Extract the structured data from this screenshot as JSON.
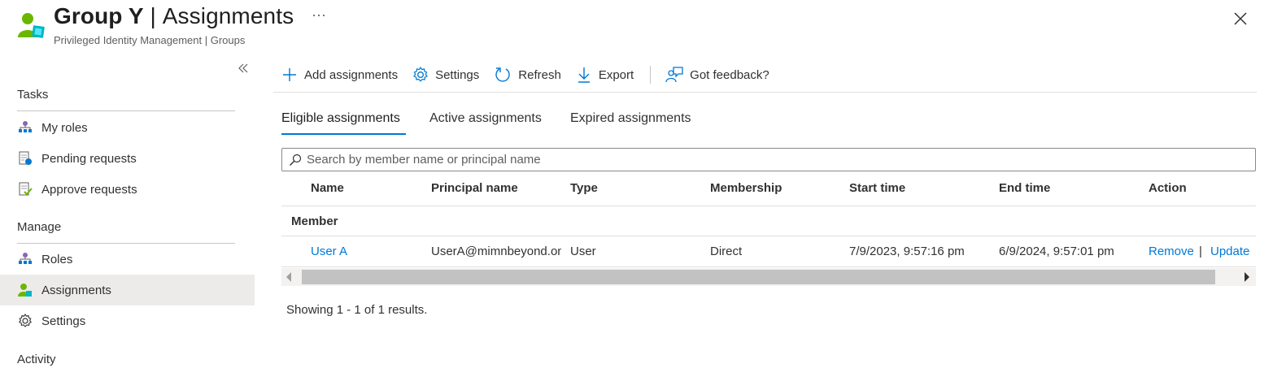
{
  "header": {
    "title_group": "Group Y",
    "title_separator": " | ",
    "title_page": "Assignments",
    "subtitle": "Privileged Identity Management | Groups",
    "more_label": "···"
  },
  "sidebar": {
    "sections": [
      {
        "heading": "Tasks",
        "items": [
          {
            "label": "My roles",
            "icon": "my-roles-icon"
          },
          {
            "label": "Pending requests",
            "icon": "pending-requests-icon"
          },
          {
            "label": "Approve requests",
            "icon": "approve-requests-icon"
          }
        ]
      },
      {
        "heading": "Manage",
        "items": [
          {
            "label": "Roles",
            "icon": "roles-icon"
          },
          {
            "label": "Assignments",
            "icon": "assignments-icon",
            "active": true
          },
          {
            "label": "Settings",
            "icon": "gear-icon"
          }
        ]
      },
      {
        "heading": "Activity",
        "items": []
      }
    ]
  },
  "toolbar": {
    "add_label": "Add assignments",
    "settings_label": "Settings",
    "refresh_label": "Refresh",
    "export_label": "Export",
    "feedback_label": "Got feedback?"
  },
  "tabs": [
    {
      "label": "Eligible assignments",
      "active": true
    },
    {
      "label": "Active assignments",
      "active": false
    },
    {
      "label": "Expired assignments",
      "active": false
    }
  ],
  "search": {
    "placeholder": "Search by member name or principal name",
    "value": ""
  },
  "table": {
    "columns": [
      "Name",
      "Principal name",
      "Type",
      "Membership",
      "Start time",
      "End time",
      "Action"
    ],
    "group_label": "Member",
    "rows": [
      {
        "name": "User A",
        "principal": "UserA@mimnbeyond.onmicrosoft.com",
        "type": "User",
        "membership": "Direct",
        "start": "7/9/2023, 9:57:16 pm",
        "end": "6/9/2024, 9:57:01 pm",
        "actions": [
          "Remove",
          "Update"
        ]
      }
    ]
  },
  "results_text": "Showing 1 - 1 of 1 results.",
  "colors": {
    "accent": "#0078d4",
    "active_bg": "#edebe9",
    "icon_green": "#6bb700",
    "icon_teal": "#00b7c3"
  }
}
